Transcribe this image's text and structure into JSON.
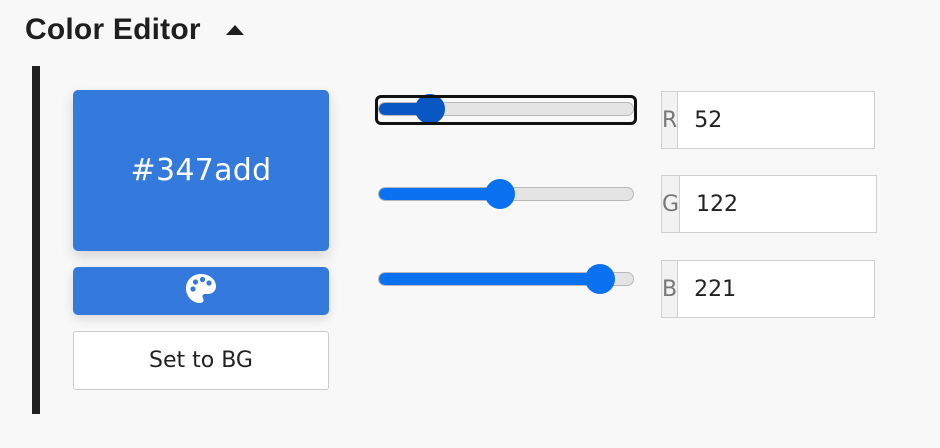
{
  "header": {
    "title": "Color Editor",
    "toggle_icon": "caret-up-icon"
  },
  "color": {
    "hex": "#347add",
    "swatch_color": "#347add",
    "accent_color": "#0a72f0",
    "focus_fill_color": "#0857c3"
  },
  "palette_button": {
    "icon": "palette-icon"
  },
  "bg_button": {
    "label": "Set to BG"
  },
  "channels": [
    {
      "label": "R",
      "value": "52",
      "level": 0.204,
      "focused": true
    },
    {
      "label": "G",
      "value": "122",
      "level": 0.478,
      "focused": false
    },
    {
      "label": "B",
      "value": "221",
      "level": 0.867,
      "focused": false
    }
  ]
}
